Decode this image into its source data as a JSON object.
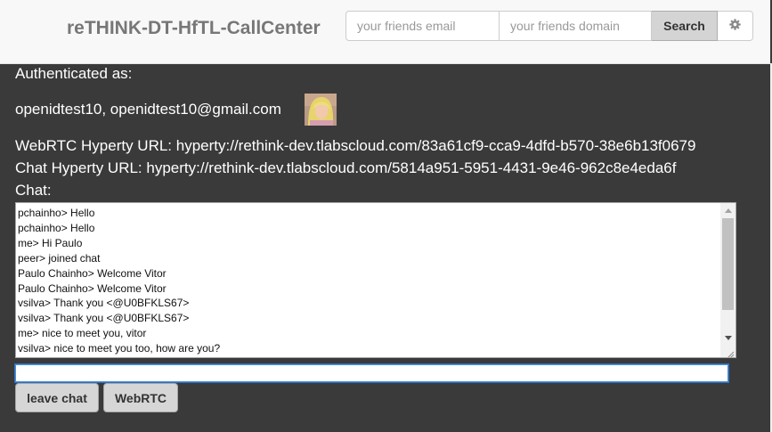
{
  "header": {
    "brand": "reTHINK-DT-HfTL-CallCenter",
    "email_placeholder": "your friends email",
    "domain_placeholder": "your friends domain",
    "search_label": "Search",
    "settings_icon": "gear-icon"
  },
  "identity": {
    "authenticated_label": "Authenticated as:",
    "user": "openidtest10, openidtest10@gmail.com",
    "avatar": "user-avatar"
  },
  "hyperty": {
    "webrtc": "WebRTC Hyperty URL: hyperty://rethink-dev.tlabscloud.com/83a61cf9-cca9-4dfd-b570-38e6b13f0679",
    "chat": "Chat Hyperty URL: hyperty://rethink-dev.tlabscloud.com/5814a951-5951-4431-9e46-962c8e4eda6f"
  },
  "chat": {
    "label": "Chat:",
    "messages": [
      "pchainho> Hello",
      "pchainho> Hello",
      "me> Hi Paulo",
      "peer> joined chat",
      "Paulo Chainho> Welcome Vitor",
      "Paulo Chainho> Welcome Vitor",
      "vsilva> Thank you <@U0BFKLS67>",
      "vsilva> Thank you <@U0BFKLS67>",
      "me> nice to meet you, vitor",
      "vsilva> nice to meet you too, how are you?"
    ],
    "input_value": ""
  },
  "actions": {
    "leave_label": "leave chat",
    "webrtc_label": "WebRTC"
  }
}
